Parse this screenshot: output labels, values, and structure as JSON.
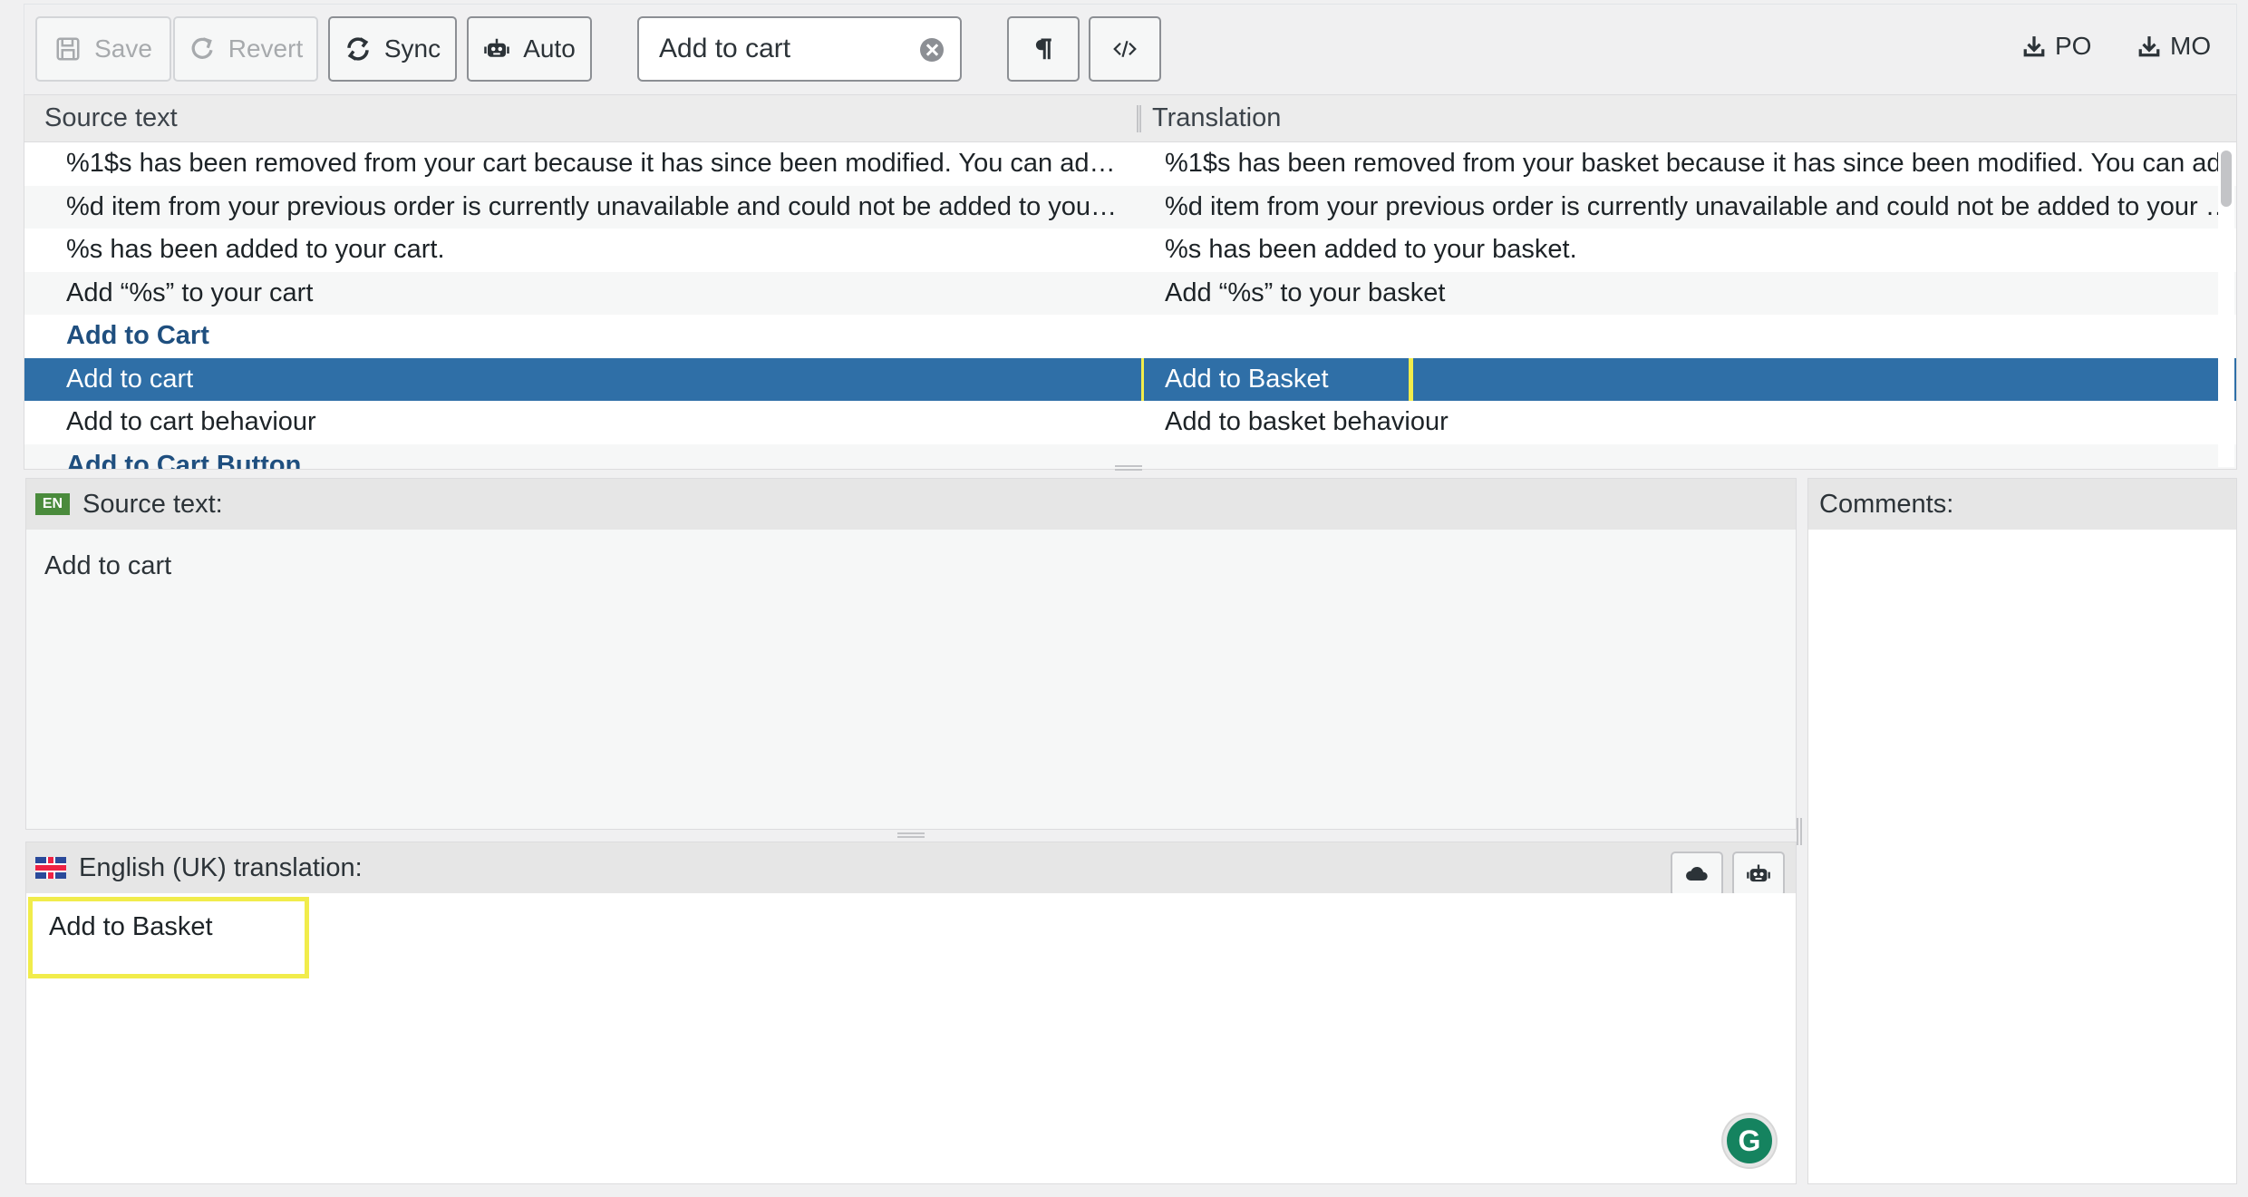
{
  "toolbar": {
    "save_label": "Save",
    "revert_label": "Revert",
    "sync_label": "Sync",
    "auto_label": "Auto",
    "search_value": "Add to cart",
    "po_label": "PO",
    "mo_label": "MO"
  },
  "grid": {
    "source_header": "Source text",
    "translation_header": "Translation",
    "rows": [
      {
        "source": "%1$s has been removed from your cart because it has since been modified. You can ad…",
        "translation": "%1$s has been removed from your basket because it has since been modified. You can ad…"
      },
      {
        "source": "%d item from your previous order is currently unavailable and could not be added to you…",
        "translation": "%d item from your previous order is currently unavailable and could not be added to your …"
      },
      {
        "source": "%s has been added to your cart.",
        "translation": "%s has been added to your basket."
      },
      {
        "source": "Add “%s” to your cart",
        "translation": "Add “%s” to your basket"
      },
      {
        "source": "Add to Cart",
        "translation": ""
      },
      {
        "source": "Add to cart",
        "translation": "Add to Basket"
      },
      {
        "source": "Add to cart behaviour",
        "translation": "Add to basket behaviour"
      },
      {
        "source": "Add to Cart Button",
        "translation": ""
      }
    ]
  },
  "source_panel": {
    "lang_code": "EN",
    "title": "Source text:",
    "text": "Add to cart"
  },
  "translation_panel": {
    "title": "English (UK) translation:",
    "text": "Add to Basket",
    "grammarly_letter": "G"
  },
  "comments_panel": {
    "title": "Comments:"
  },
  "colors": {
    "selected_row": "#2f6fa7",
    "untranslated_text": "#1f4f7f",
    "highlight": "#f1ec4b"
  }
}
